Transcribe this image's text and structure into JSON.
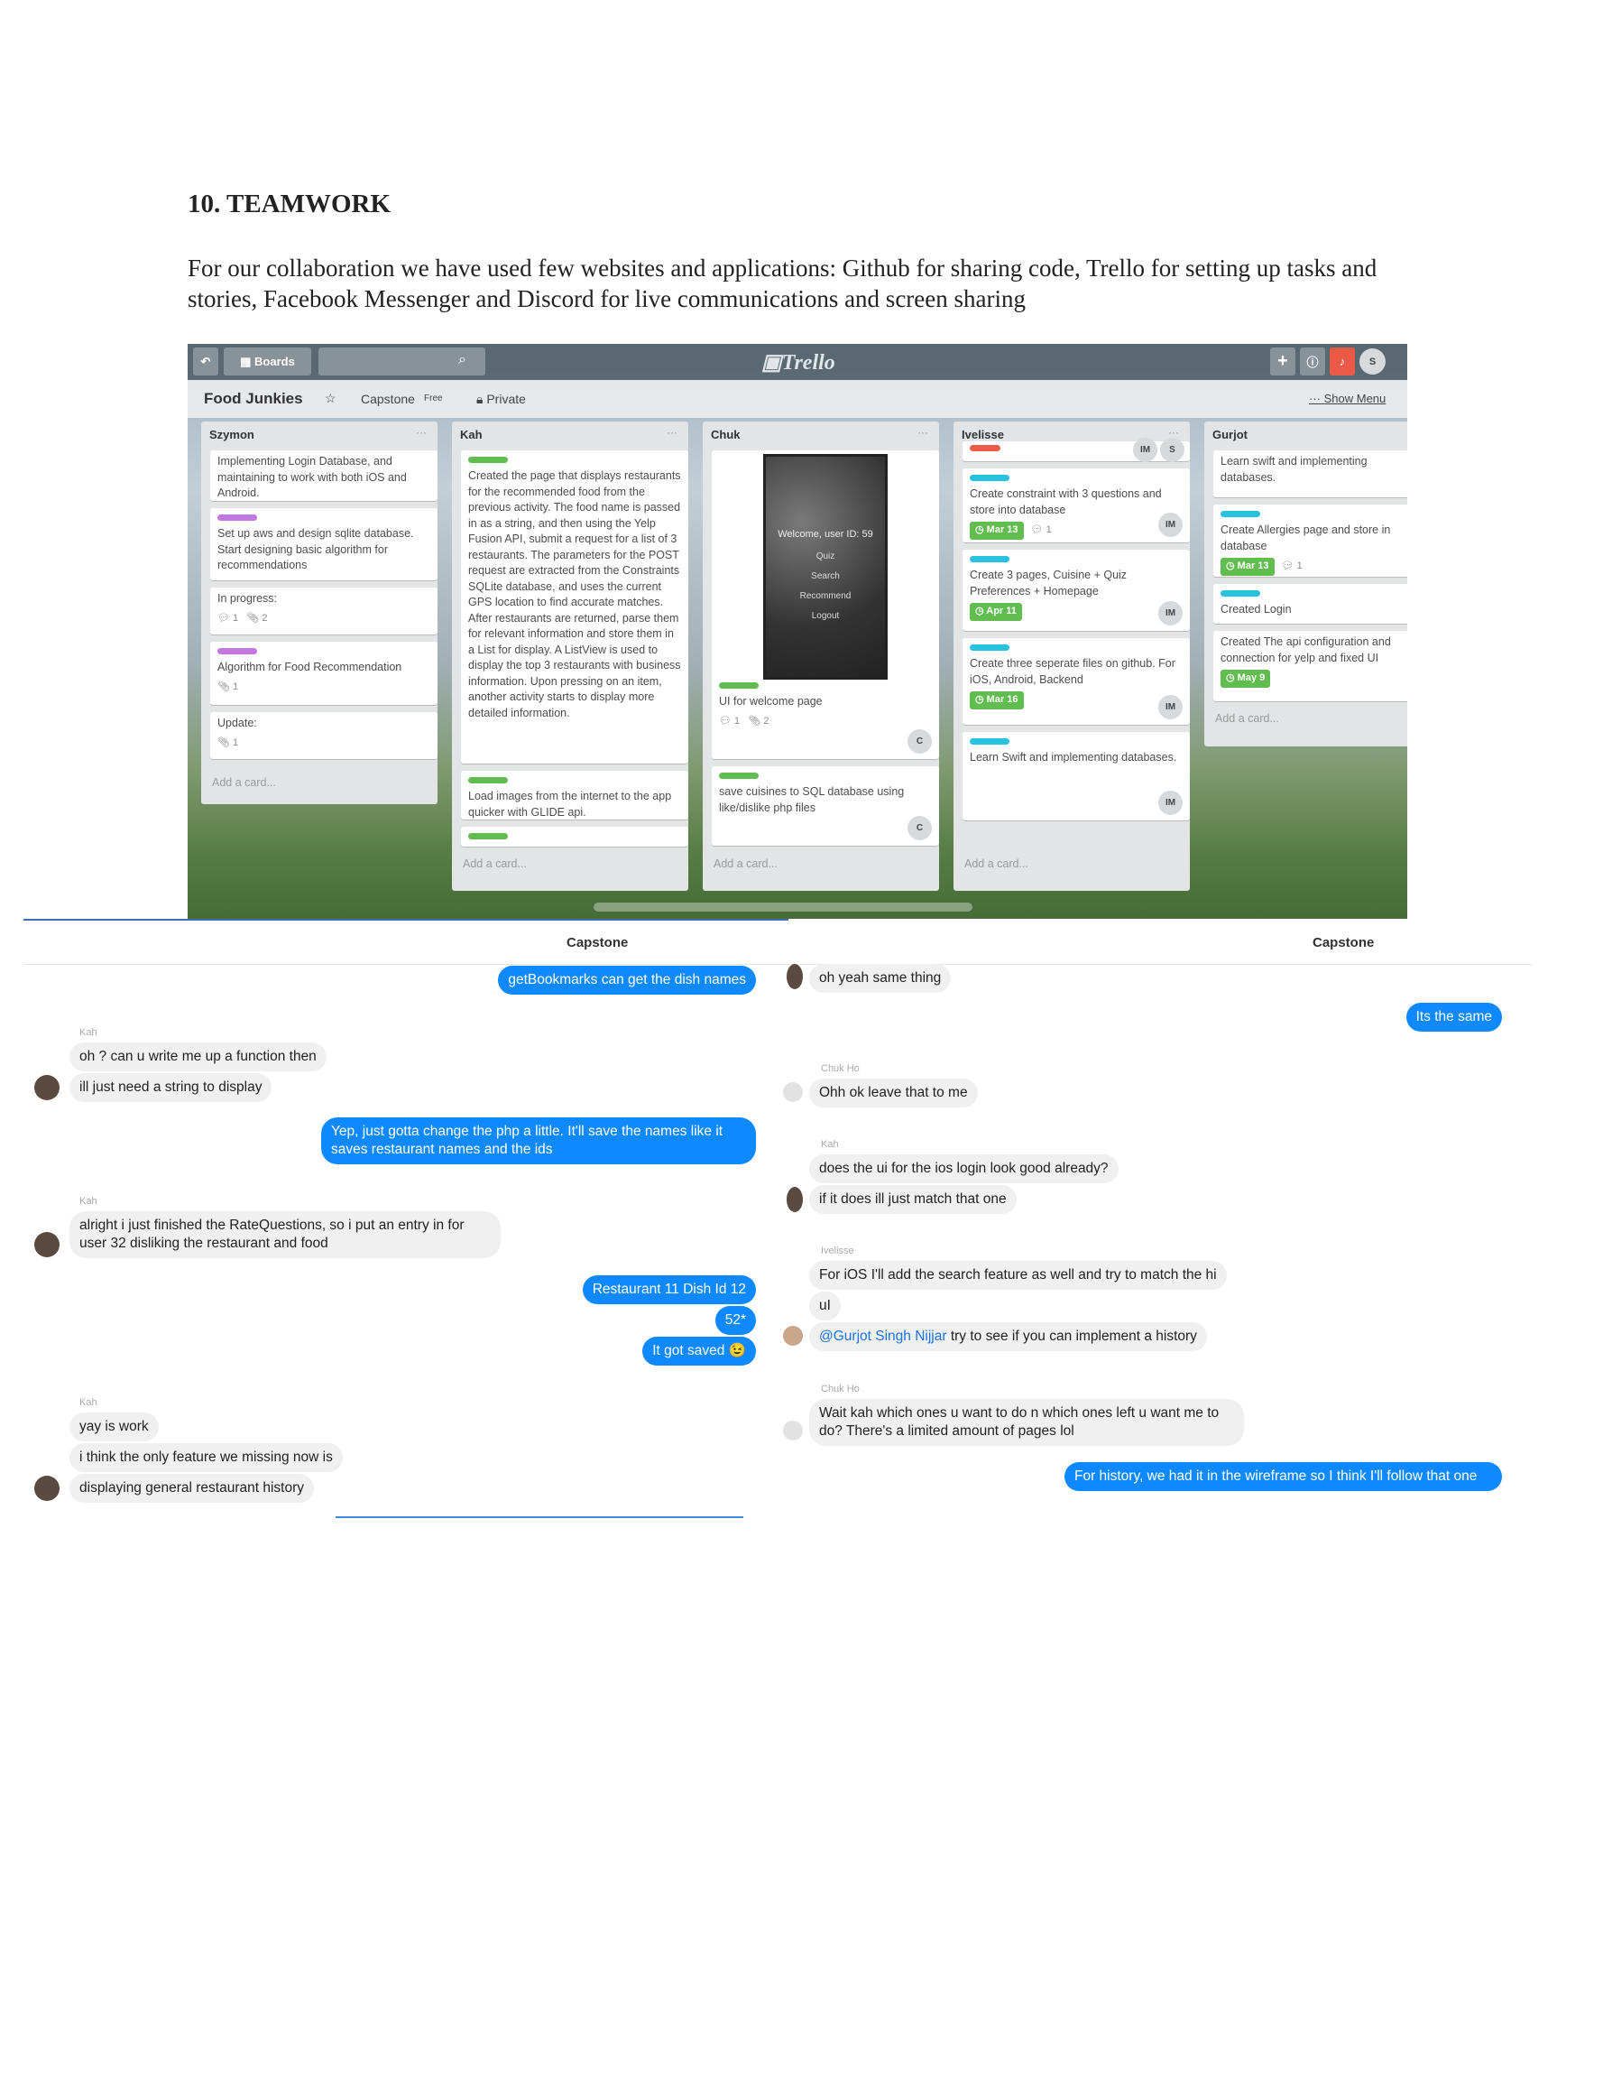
{
  "doc": {
    "heading": "10. TEAMWORK",
    "paragraph": "For our collaboration we have used few websites and applications: Github for sharing code, Trello for setting up tasks and stories, Facebook Messenger and Discord for live communications and screen sharing"
  },
  "trello": {
    "boards_label": "Boards",
    "logo": "Trello",
    "board_name": "Food Junkies",
    "team": "Capstone",
    "plan": "Free",
    "visibility": "Private",
    "show_menu": "Show Menu",
    "avatar": "S",
    "add_card": "Add a card...",
    "lists": [
      {
        "title": "Szymon",
        "cards": [
          {
            "text": "Implementing Login Database, and maintaining to work with both iOS and Android."
          },
          {
            "text": "Set up aws and design sqlite database. Start designing basic algorithm for recommendations"
          },
          {
            "text": "In progress:",
            "comments": "1",
            "attachments": "2"
          },
          {
            "text": "Algorithm for Food Recommendation",
            "attachments": "1"
          },
          {
            "text": "Update:",
            "attachments": "1"
          }
        ]
      },
      {
        "title": "Kah",
        "cards": [
          {
            "text": "Created the page that displays restaurants for the recommended food from the previous activity. The food name is passed in as a string, and then using the Yelp Fusion API, submit a request for a list of 3 restaurants. The parameters for the POST request are extracted from the Constraints SQLite database, and uses the current GPS location to find accurate matches. After restaurants are returned, parse them for relevant information and store them in a List for display. A ListView is used to display the top 3 restaurants with business information. Upon pressing on an item, another activity starts to display more detailed information."
          },
          {
            "text": "Load images from the internet to the app quicker with GLIDE api."
          }
        ]
      },
      {
        "title": "Chuk",
        "cards": [
          {
            "text": "UI for welcome page",
            "comments": "1",
            "attachments": "2",
            "member": "C",
            "shot": {
              "welcome": "Welcome, user ID: 59",
              "items": [
                "Quiz",
                "Search",
                "Recommend",
                "Logout"
              ]
            }
          },
          {
            "text": "save cuisines to SQL database using like/dislike php files",
            "member": "C"
          }
        ]
      },
      {
        "title": "Ivelisse",
        "cards": [
          {
            "text": "Create constraint with 3 questions and store into database",
            "due": "Mar 13",
            "comments": "1",
            "member": "IM"
          },
          {
            "text": "Create 3 pages, Cuisine + Quiz Preferences + Homepage",
            "due": "Apr 11",
            "member": "IM"
          },
          {
            "text": "Create three seperate files on github. For iOS, Android, Backend",
            "due": "Mar 16",
            "member": "IM"
          },
          {
            "text": "Learn Swift and implementing databases.",
            "member": "IM"
          }
        ],
        "top_members": [
          "IM",
          "S"
        ]
      },
      {
        "title": "Gurjot",
        "cards": [
          {
            "text": "Learn swift and implementing databases."
          },
          {
            "text": "Create Allergies page and store in database",
            "due": "Mar 13",
            "comments": "1"
          },
          {
            "text": "Created Login"
          },
          {
            "text": "Created The api configuration and connection for yelp and fixed UI",
            "due": "May 9"
          }
        ]
      }
    ]
  },
  "chat_left": {
    "title": "Capstone",
    "messages": [
      {
        "text": "getBookmarks can get the dish names"
      },
      {
        "sender": "Kah",
        "text": "oh ? can u write me up a function then"
      },
      {
        "text": "ill just need a string to display"
      },
      {
        "text": "Yep, just gotta change the php a little. It'll save the names like it saves restaurant names and the ids"
      },
      {
        "sender": "Kah",
        "text": "alright i just finished the RateQuestions, so i put an entry in for user 32 disliking the restaurant and food"
      },
      {
        "text": "Restaurant 11 Dish Id 12"
      },
      {
        "text": "52*"
      },
      {
        "text": "It got saved 😉"
      },
      {
        "sender": "Kah",
        "text": "yay is work"
      },
      {
        "text": "i think the only feature we missing now is"
      },
      {
        "text": "displaying general restaurant history"
      }
    ]
  },
  "chat_right": {
    "title": "Capstone",
    "messages": [
      {
        "text": "oh yeah same thing"
      },
      {
        "text": "Its the same"
      },
      {
        "sender": "Chuk Ho",
        "text": "Ohh ok leave that to me"
      },
      {
        "sender": "Kah",
        "text": "does the ui for the ios login look good already?"
      },
      {
        "text": "if it does ill just match that one"
      },
      {
        "sender": "Ivelisse",
        "text": "For iOS I'll add the search feature as well and try to match the hi"
      },
      {
        "text": "uI"
      },
      {
        "mention": "@Gurjot Singh Nijjar",
        "text": "try to see if you can implement a history"
      },
      {
        "sender": "Chuk Ho",
        "text": "Wait kah which ones u want to do n which ones left u want me to do? There's a limited amount of pages lol"
      },
      {
        "text": "For history, we had it in the wireframe so I think I'll follow that one"
      }
    ]
  },
  "colors": {
    "messenger_blue": "#0f89ff",
    "trello_green": "#61bd4f",
    "trello_purple": "#c377e0",
    "trello_blue": "#29c1e0"
  }
}
